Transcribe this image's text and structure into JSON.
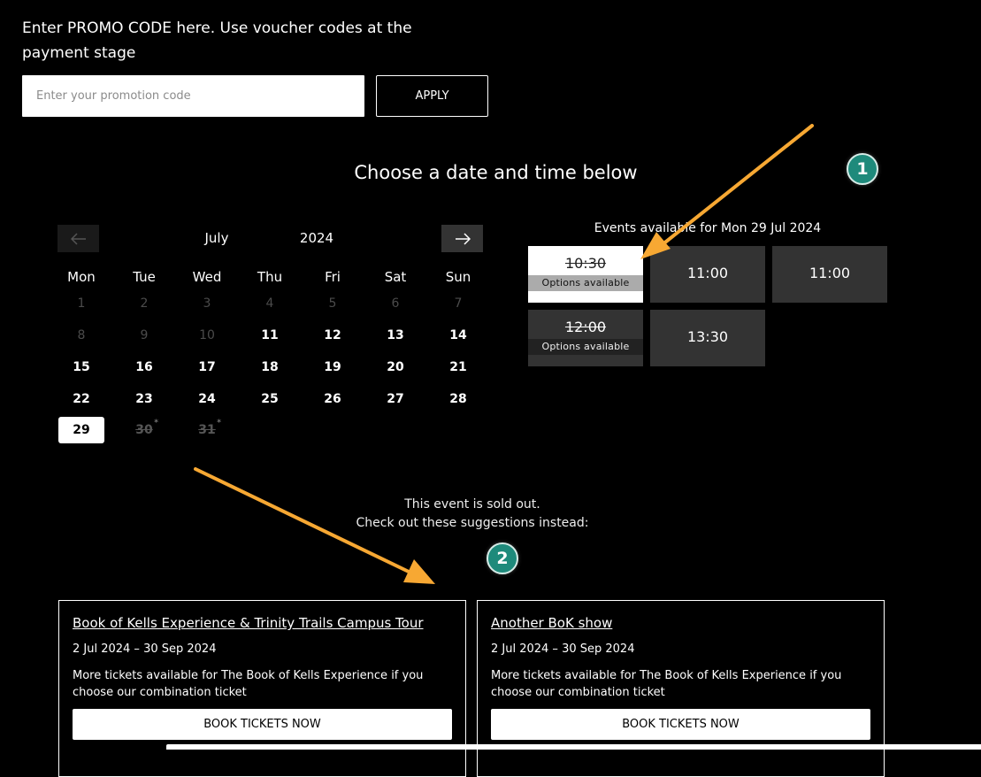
{
  "promo": {
    "text": "Enter PROMO CODE here. Use voucher codes at the payment stage",
    "placeholder": "Enter your promotion code",
    "apply_label": "APPLY"
  },
  "heading": "Choose a date and time below",
  "calendar": {
    "month": "July",
    "year": "2024",
    "weekdays": [
      "Mon",
      "Tue",
      "Wed",
      "Thu",
      "Fri",
      "Sat",
      "Sun"
    ],
    "days": [
      {
        "n": "1",
        "s": "past"
      },
      {
        "n": "2",
        "s": "past"
      },
      {
        "n": "3",
        "s": "past"
      },
      {
        "n": "4",
        "s": "past"
      },
      {
        "n": "5",
        "s": "past"
      },
      {
        "n": "6",
        "s": "past"
      },
      {
        "n": "7",
        "s": "past"
      },
      {
        "n": "8",
        "s": "past"
      },
      {
        "n": "9",
        "s": "past"
      },
      {
        "n": "10",
        "s": "past"
      },
      {
        "n": "11",
        "s": "avail"
      },
      {
        "n": "12",
        "s": "avail"
      },
      {
        "n": "13",
        "s": "avail"
      },
      {
        "n": "14",
        "s": "avail"
      },
      {
        "n": "15",
        "s": "avail"
      },
      {
        "n": "16",
        "s": "avail"
      },
      {
        "n": "17",
        "s": "avail"
      },
      {
        "n": "18",
        "s": "avail"
      },
      {
        "n": "19",
        "s": "avail"
      },
      {
        "n": "20",
        "s": "avail"
      },
      {
        "n": "21",
        "s": "avail"
      },
      {
        "n": "22",
        "s": "avail"
      },
      {
        "n": "23",
        "s": "avail"
      },
      {
        "n": "24",
        "s": "avail"
      },
      {
        "n": "25",
        "s": "avail"
      },
      {
        "n": "26",
        "s": "avail"
      },
      {
        "n": "27",
        "s": "avail"
      },
      {
        "n": "28",
        "s": "avail"
      },
      {
        "n": "29",
        "s": "selected"
      },
      {
        "n": "30",
        "s": "sold",
        "star": "*"
      },
      {
        "n": "31",
        "s": "sold",
        "star": "*"
      }
    ],
    "prev_icon": "arrow-left-icon",
    "next_icon": "arrow-right-icon"
  },
  "events": {
    "heading": "Events available for Mon 29 Jul 2024",
    "slots": [
      {
        "time": "10:30",
        "label": "Options available",
        "style": "white"
      },
      {
        "time": "11:00",
        "label": "",
        "style": "plain"
      },
      {
        "time": "11:00",
        "label": "",
        "style": "plain"
      },
      {
        "time": "12:00",
        "label": "Options available",
        "style": "dark"
      },
      {
        "time": "13:30",
        "label": "",
        "style": "plain"
      }
    ]
  },
  "soldout": {
    "line1": "This event is sold out.",
    "line2": "Check out these suggestions instead:"
  },
  "badges": [
    "1",
    "2"
  ],
  "cards": [
    {
      "title": "Book of Kells Experience & Trinity Trails Campus Tour",
      "dates": "2 Jul 2024 – 30 Sep 2024",
      "desc": "More tickets available for The Book of Kells Experience if you choose our combination ticket",
      "button": "BOOK TICKETS NOW"
    },
    {
      "title": "Another BoK show",
      "dates": "2 Jul 2024 – 30 Sep 2024",
      "desc": "More tickets available for The Book of Kells Experience if you choose our combination ticket",
      "button": "BOOK TICKETS NOW"
    }
  ],
  "colors": {
    "arrow": "#f7a833",
    "badge": "#1e8a7b",
    "slot": "#333333"
  }
}
